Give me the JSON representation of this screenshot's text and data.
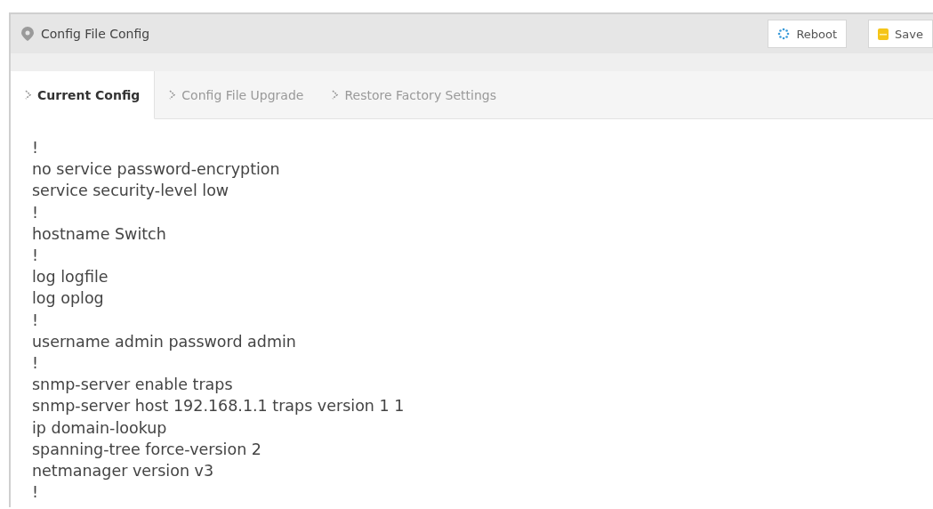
{
  "panel": {
    "title": "Config File Config"
  },
  "buttons": [
    {
      "kind": "reboot",
      "label": "Reboot"
    },
    {
      "kind": "save",
      "label": "Save"
    }
  ],
  "tabs": [
    {
      "label": "Current Config",
      "selected": true
    },
    {
      "label": "Config File Upgrade",
      "selected": false
    },
    {
      "label": "Restore Factory Settings",
      "selected": false
    }
  ],
  "config_lines": [
    "!",
    "no service password-encryption",
    "service security-level low",
    "!",
    "hostname Switch",
    "!",
    "log logfile",
    "log oplog",
    "!",
    "username admin password admin",
    "!",
    "snmp-server enable traps",
    "snmp-server host 192.168.1.1 traps version 1 1",
    "ip domain-lookup",
    "spanning-tree force-version 2",
    "netmanager version v3",
    "!"
  ]
}
